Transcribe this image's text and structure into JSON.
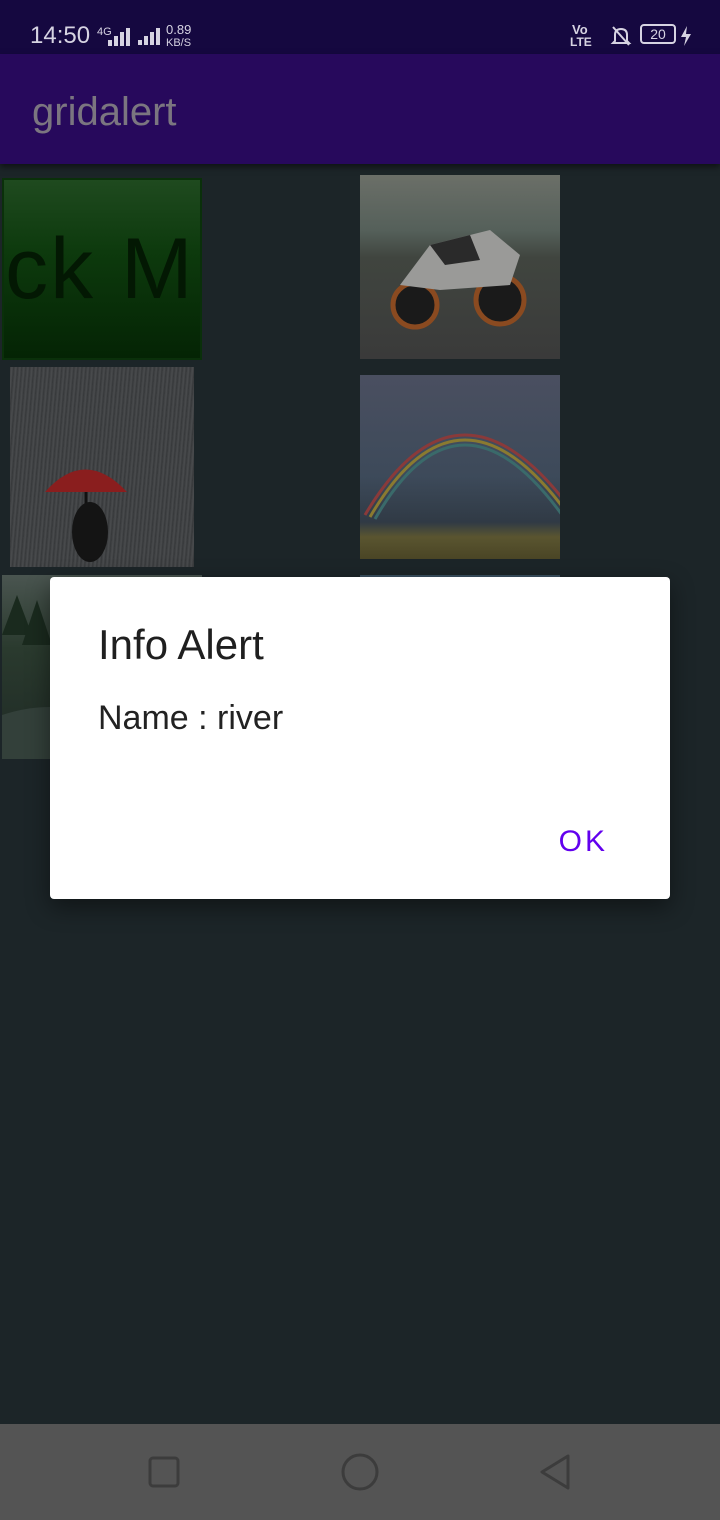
{
  "status_bar": {
    "time": "14:50",
    "network_type": "4G",
    "speed_value": "0.89",
    "speed_unit": "KB/S",
    "volte_top": "Vo",
    "volte_bottom": "LTE",
    "battery": "20"
  },
  "app_bar": {
    "title": "gridalert"
  },
  "grid": {
    "items": [
      {
        "icon": "click-me-banner",
        "text": "ick M"
      },
      {
        "icon": "motorcycle-photo"
      },
      {
        "icon": "rain-umbrella-photo"
      },
      {
        "icon": "rainbow-photo"
      },
      {
        "icon": "river-photo"
      },
      {
        "icon": "sky-photo"
      }
    ]
  },
  "dialog": {
    "title": "Info Alert",
    "message": "Name : river",
    "ok_label": "OK",
    "accent_color": "#6200ee"
  },
  "nav_bar": {
    "recents_icon": "square-icon",
    "home_icon": "circle-icon",
    "back_icon": "triangle-back-icon"
  }
}
